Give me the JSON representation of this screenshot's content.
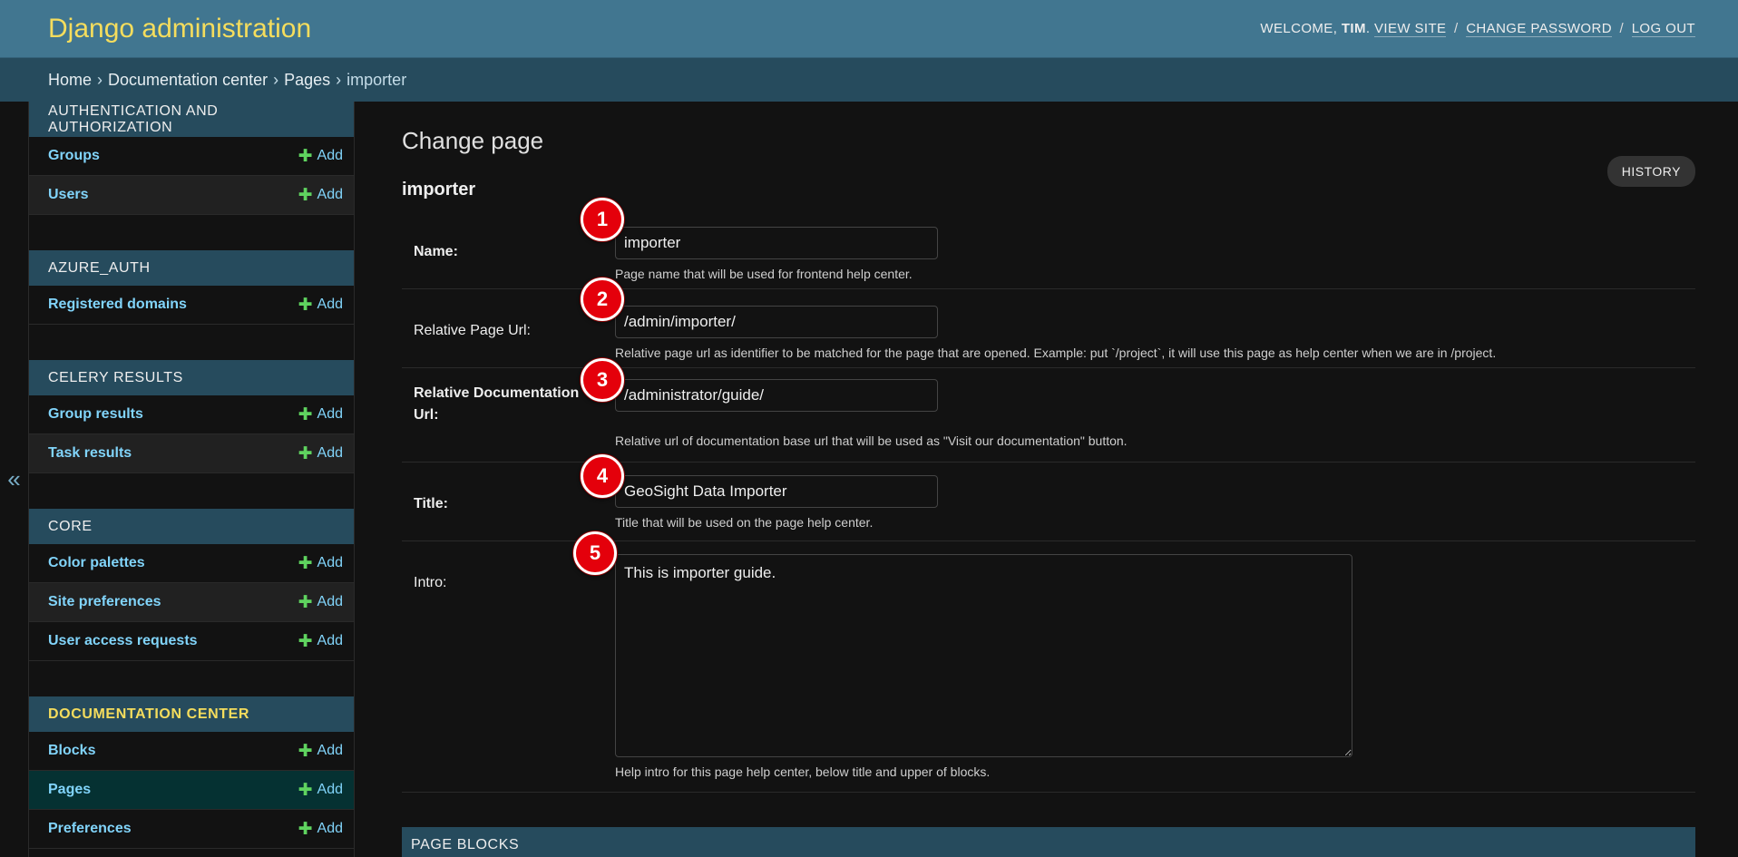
{
  "header": {
    "site_name": "Django administration",
    "welcome_text": "Welcome,",
    "username": "Tim",
    "view_site": "View site",
    "change_password": "Change password",
    "log_out": "Log out",
    "brand_color": "#f5dd5d",
    "header_color": "#417690"
  },
  "breadcrumbs": [
    "Home",
    "Documentation center",
    "Pages",
    "importer"
  ],
  "nav_toggle_glyph": "«",
  "sidebar": {
    "add_label": "Add",
    "apps": [
      {
        "name": "Authentication and Authorization",
        "models": [
          "Groups",
          "Users"
        ]
      },
      {
        "name": "AZURE_AUTH",
        "models": [
          "Registered domains"
        ]
      },
      {
        "name": "Celery Results",
        "models": [
          "Group results",
          "Task results"
        ]
      },
      {
        "name": "Core",
        "models": [
          "Color palettes",
          "Site preferences",
          "User access requests"
        ]
      },
      {
        "name": "Documentation Center",
        "models": [
          "Blocks",
          "Pages",
          "Preferences"
        ]
      }
    ]
  },
  "content": {
    "title": "Change page",
    "history_label": "History",
    "object_name": "importer",
    "fields": {
      "name": {
        "label": "Name:",
        "value": "importer",
        "help": "Page name that will be used for frontend help center."
      },
      "relative_page_url": {
        "label": "Relative Page Url:",
        "value": "/admin/importer/",
        "help": "Relative page url as identifier to be matched for the page that are opened. Example: put `/project`, it will use this page as help center when we are in /project."
      },
      "relative_doc_url": {
        "label": "Relative Documentation Url:",
        "value": "/administrator/guide/",
        "help": "Relative url of documentation base url that will be used as \"Visit our documentation\" button."
      },
      "title": {
        "label": "Title:",
        "value": "GeoSight Data Importer",
        "help": "Title that will be used on the page help center."
      },
      "intro": {
        "label": "Intro:",
        "value": "This is importer guide.",
        "help": "Help intro for this page help center, below title and upper of blocks."
      }
    },
    "page_blocks_header": "Page Blocks"
  },
  "markers": [
    "1",
    "2",
    "3",
    "4",
    "5"
  ]
}
